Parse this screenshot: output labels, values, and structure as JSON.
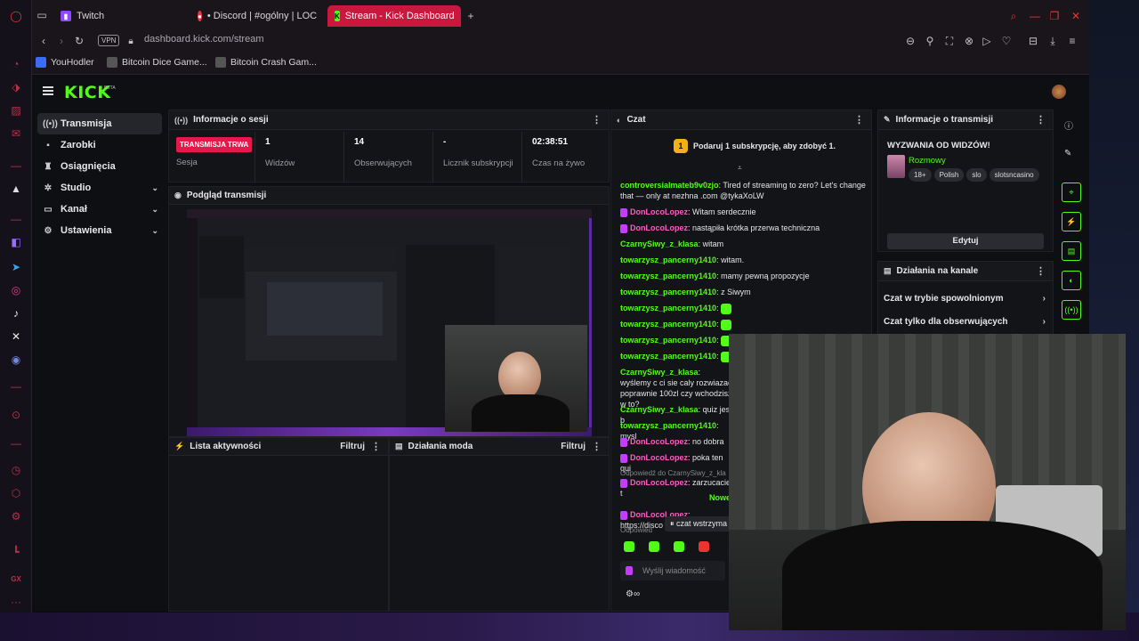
{
  "browser": {
    "tabs": [
      {
        "label": "Twitch",
        "active": false
      },
      {
        "label": "• Discord | #ogólny | LOC",
        "active": false
      },
      {
        "label": "Stream - Kick Dashboard",
        "active": true
      }
    ],
    "vpn_label": "VPN",
    "url": "dashboard.kick.com/stream",
    "bookmarks": [
      "YouHodler",
      "Bitcoin Dice Game...",
      "Bitcoin Crash Gam..."
    ],
    "left_rail_icons": [
      "opera-icon",
      "speed-icon",
      "crypto-icon",
      "gmail-icon",
      "brand-icon",
      "twitch-icon",
      "telegram-icon",
      "instagram-icon",
      "tiktok-icon",
      "x-icon",
      "discord-icon",
      "record-icon",
      "clock-icon",
      "box-icon",
      "settings-icon",
      "gx-icon",
      "more-icon"
    ]
  },
  "kick": {
    "logo": "KICK",
    "logo_badge": "BETA",
    "nav": [
      {
        "label": "Transmisja",
        "icon": "broadcast-icon",
        "active": true,
        "expandable": false
      },
      {
        "label": "Zarobki",
        "icon": "wallet-icon",
        "active": false,
        "expandable": false
      },
      {
        "label": "Osiągnięcia",
        "icon": "trophy-icon",
        "active": false,
        "expandable": false
      },
      {
        "label": "Studio",
        "icon": "studio-icon",
        "active": false,
        "expandable": true
      },
      {
        "label": "Kanał",
        "icon": "channel-icon",
        "active": false,
        "expandable": true
      },
      {
        "label": "Ustawienia",
        "icon": "settings-icon",
        "active": false,
        "expandable": true
      }
    ],
    "session": {
      "title": "Informacje o sesji",
      "live_badge": "TRANSMISJA TRWA",
      "session_label": "Sesja",
      "stats": [
        {
          "value": "1",
          "label": "Widzów"
        },
        {
          "value": "14",
          "label": "Obserwujących"
        },
        {
          "value": "-",
          "label": "Licznik subskrypcji"
        },
        {
          "value": "02:38:51",
          "label": "Czas na żywo"
        }
      ]
    },
    "preview": {
      "title": "Podgląd transmisji"
    },
    "activity": {
      "title": "Lista aktywności",
      "filter": "Filtruj"
    },
    "mod": {
      "title": "Działania moda",
      "filter": "Filtruj"
    },
    "chat": {
      "title": "Czat",
      "gift_banner": "Podaruj 1 subskrypcję, aby zdobyć 1.",
      "messages": [
        {
          "user": "controversialmateb9v0zjo",
          "text": "Tired of streaming to zero? Let's change that — only at nezhna .com @tykaXoLW",
          "color": "green",
          "badge": false
        },
        {
          "user": "DonLocoLopez",
          "text": "Witam serdecznie",
          "color": "pink",
          "badge": true
        },
        {
          "user": "DonLocoLopez",
          "text": "nastąpiła krótka przerwa techniczna",
          "color": "pink",
          "badge": true
        },
        {
          "user": "CzarnySiwy_z_klasa",
          "text": "witam",
          "color": "green",
          "badge": false
        },
        {
          "user": "towarzysz_pancerny1410",
          "text": "witam.",
          "color": "green",
          "badge": false
        },
        {
          "user": "towarzysz_pancerny1410",
          "text": "mamy pewną propozycje",
          "color": "green",
          "badge": false
        },
        {
          "user": "towarzysz_pancerny1410",
          "text": "z Siwym",
          "color": "green",
          "badge": false
        },
        {
          "user": "towarzysz_pancerny1410",
          "text": "",
          "color": "green",
          "badge": false,
          "emote": true
        },
        {
          "user": "towarzysz_pancerny1410",
          "text": "",
          "color": "green",
          "badge": false,
          "emote": true
        },
        {
          "user": "towarzysz_pancerny1410",
          "text": "",
          "color": "green",
          "badge": false,
          "emote": true
        },
        {
          "user": "towarzysz_pancerny1410",
          "text": "",
          "color": "green",
          "badge": false,
          "emote": true
        },
        {
          "user": "CzarnySiwy_z_klasa",
          "text": "wyślemy c ci sie caly rozwiazac poprawnie 100zl czy wchodzisz w to?",
          "color": "green",
          "badge": false
        },
        {
          "user": "CzarnySiwy_z_klasa",
          "text": "quiz jest b",
          "color": "green",
          "badge": false
        },
        {
          "user": "towarzysz_pancerny1410",
          "text": "mysl",
          "color": "green",
          "badge": false
        },
        {
          "user": "DonLocoLopez",
          "text": "no dobra",
          "color": "pink",
          "badge": true
        },
        {
          "user": "DonLocoLopez",
          "text": "poka ten qui",
          "color": "pink",
          "badge": true
        },
        {
          "user": "DonLocoLopez",
          "text": "zarzucacie t",
          "color": "pink",
          "badge": true
        },
        {
          "user": "DonLocoLopez",
          "text": "https://disco",
          "color": "pink",
          "badge": true
        }
      ],
      "reply_hint": "Odpowiedź do CzarnySiwy_z_kla",
      "reply_hint2": "Odpowied",
      "new_label": "Nowe",
      "paused_label": "czat wstrzyma",
      "input_placeholder": "Wyślij wiadomość"
    },
    "stream_info": {
      "title": "Informacje o transmisji",
      "stream_title": "WYZWANIA OD WIDZÓW!",
      "category": "Rozmowy",
      "tags": [
        "18+",
        "Polish",
        "slo",
        "slotsncasino"
      ],
      "edit_label": "Edytuj"
    },
    "channel_actions": {
      "title": "Działania na kanale",
      "items": [
        "Czat w trybie spowolnionym",
        "Czat tylko dla obserwujących"
      ]
    },
    "right_tools": [
      "info-icon",
      "edit-icon",
      "crosshair-icon",
      "bolt-icon",
      "clipboard-icon",
      "chat-bubble-icon",
      "broadcast-icon"
    ]
  },
  "colors": {
    "kick_green": "#53fc18",
    "live_red": "#e5184b",
    "opera_red": "#c8183d"
  }
}
